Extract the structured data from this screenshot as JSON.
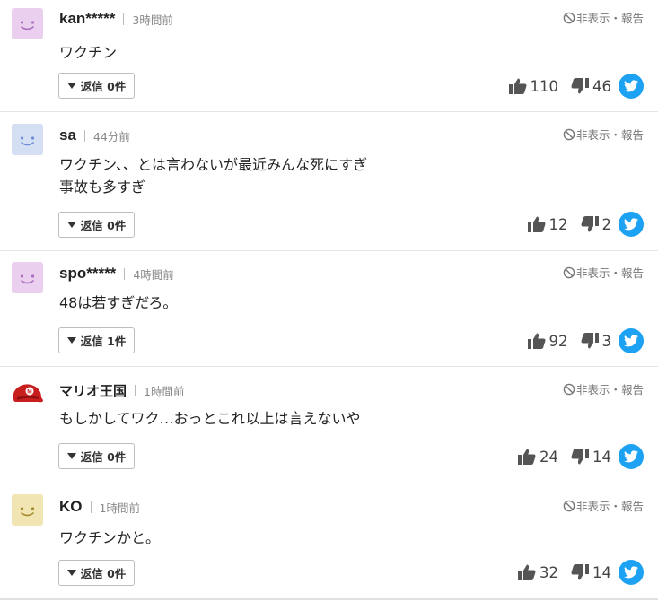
{
  "hide_label": "非表示・報告",
  "comments": [
    {
      "user": "kan*****",
      "time": "3時間前",
      "lines": [
        "ワクチン"
      ],
      "reply": "返信 0件",
      "likes": "110",
      "dislikes": "46",
      "avatar": "smile-pink"
    },
    {
      "user": "sa",
      "time": "44分前",
      "lines": [
        "ワクチン、、とは言わないが最近みんな死にすぎ",
        "事故も多すぎ"
      ],
      "reply": "返信 0件",
      "likes": "12",
      "dislikes": "2",
      "avatar": "smile-blue"
    },
    {
      "user": "spo*****",
      "time": "4時間前",
      "lines": [
        "48は若すぎだろ。"
      ],
      "reply": "返信 1件",
      "likes": "92",
      "dislikes": "3",
      "avatar": "smile-pink"
    },
    {
      "user": "マリオ王国",
      "time": "1時間前",
      "lines": [
        "もしかしてワク…おっとこれ以上は言えないや"
      ],
      "reply": "返信 0件",
      "likes": "24",
      "dislikes": "14",
      "avatar": "mario-cap"
    },
    {
      "user": "KO",
      "time": "1時間前",
      "lines": [
        "ワクチンかと。"
      ],
      "reply": "返信 0件",
      "likes": "32",
      "dislikes": "14",
      "avatar": "smile-yellow"
    }
  ],
  "colors": {
    "twitter": "#1da1f2",
    "text": "#222222",
    "muted": "#888888",
    "border": "#e6e6e6"
  }
}
